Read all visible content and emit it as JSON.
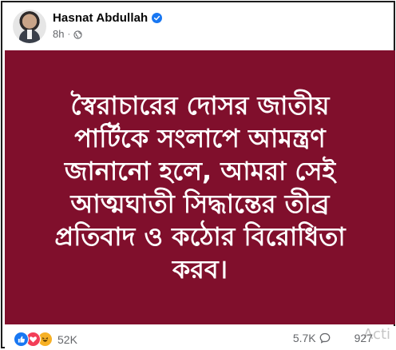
{
  "post": {
    "author_name": "Hasnat Abdullah",
    "time": "8h",
    "separator": "·"
  },
  "image": {
    "background_color": "#800f2c",
    "text": "স্বৈরাচারের দোসর জাতীয় পার্টিকে সংলাপে আমন্ত্রণ জানানো হলে, আমরা সেই আত্মঘাতী সিদ্ধান্তের তীব্র প্রতিবাদ ও কঠোর বিরোধিতা করব।"
  },
  "footer": {
    "reactions": [
      "like-icon",
      "love-icon",
      "haha-icon"
    ],
    "reaction_count": "52K",
    "comments_count": "5.7K",
    "shares_count": "927",
    "watermark": "Acti"
  },
  "colors": {
    "verified": "#1877f2",
    "like": "#1877f2",
    "love": "#f33e58",
    "haha": "#f7b125"
  }
}
